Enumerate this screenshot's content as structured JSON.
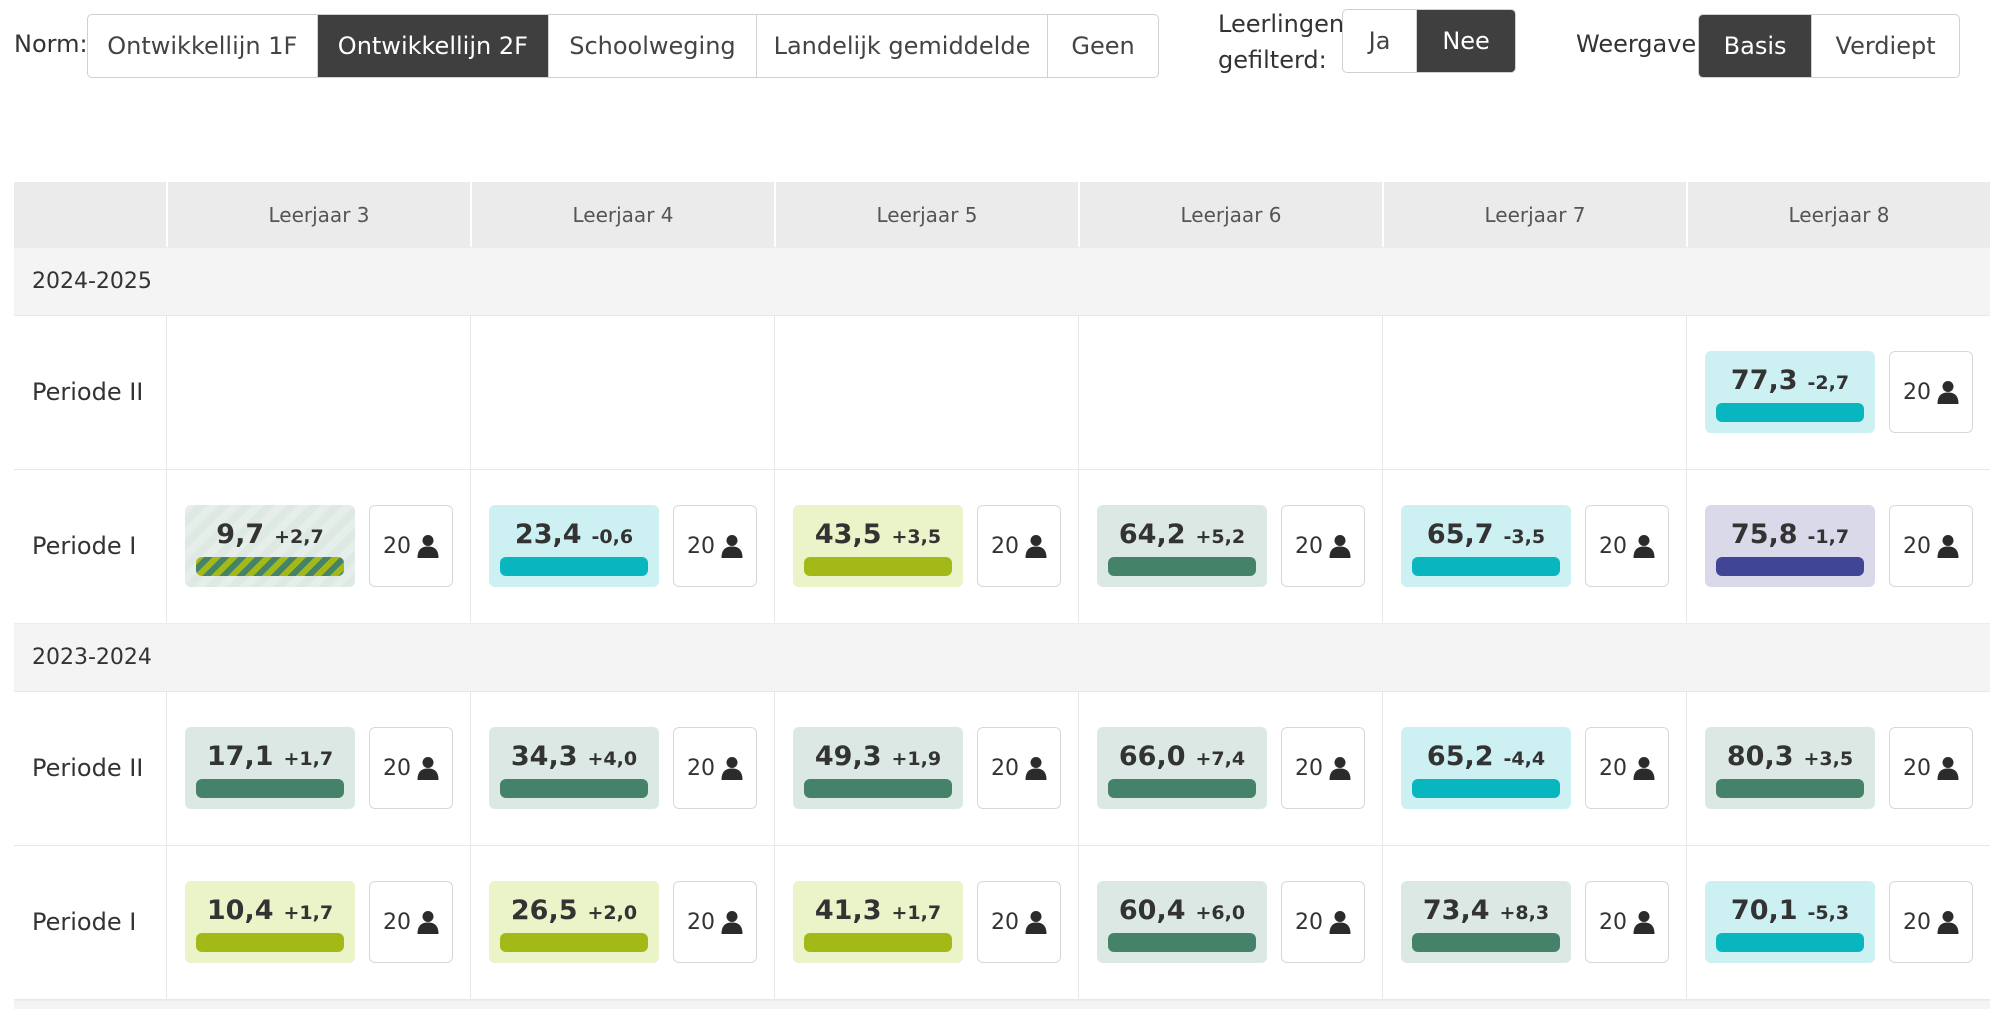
{
  "norm": {
    "label": "Norm:",
    "options": [
      "Ontwikkellijn 1F",
      "Ontwikkellijn 2F",
      "Schoolweging",
      "Landelijk gemiddelde",
      "Geen"
    ],
    "selected": "Ontwikkellijn 2F"
  },
  "leerlingen": {
    "label_line1": "Leerlingen",
    "label_line2": "gefilterd:",
    "options": [
      "Ja",
      "Nee"
    ],
    "selected": "Nee"
  },
  "weergave": {
    "label": "Weergave:",
    "options": [
      "Basis",
      "Verdiept"
    ],
    "selected": "Basis"
  },
  "colors": {
    "dark_green": {
      "bg": "#dbe8e3",
      "bar": "#44836a"
    },
    "teal": {
      "bg": "#cdf0f2",
      "bar": "#08b6c0"
    },
    "lime": {
      "bg": "#ebf3c9",
      "bar": "#a3b917"
    },
    "indigo": {
      "bg": "#d9d9ea",
      "bar": "#404596"
    },
    "striped": {
      "bg": "#e4ede9",
      "bar": "#8aa12a"
    }
  },
  "table": {
    "columns": [
      "Leerjaar 3",
      "Leerjaar 4",
      "Leerjaar 5",
      "Leerjaar 6",
      "Leerjaar 7",
      "Leerjaar 8"
    ],
    "years": [
      {
        "label": "2024-2025",
        "periods": [
          {
            "label": "Periode II",
            "cells": [
              null,
              null,
              null,
              null,
              null,
              {
                "value": "77,3",
                "delta": "-2,7",
                "count": "20",
                "color": "teal"
              }
            ]
          },
          {
            "label": "Periode I",
            "cells": [
              {
                "value": "9,7",
                "delta": "+2,7",
                "count": "20",
                "color": "striped"
              },
              {
                "value": "23,4",
                "delta": "-0,6",
                "count": "20",
                "color": "teal"
              },
              {
                "value": "43,5",
                "delta": "+3,5",
                "count": "20",
                "color": "lime"
              },
              {
                "value": "64,2",
                "delta": "+5,2",
                "count": "20",
                "color": "dark_green"
              },
              {
                "value": "65,7",
                "delta": "-3,5",
                "count": "20",
                "color": "teal"
              },
              {
                "value": "75,8",
                "delta": "-1,7",
                "count": "20",
                "color": "indigo"
              }
            ]
          }
        ]
      },
      {
        "label": "2023-2024",
        "periods": [
          {
            "label": "Periode II",
            "cells": [
              {
                "value": "17,1",
                "delta": "+1,7",
                "count": "20",
                "color": "dark_green"
              },
              {
                "value": "34,3",
                "delta": "+4,0",
                "count": "20",
                "color": "dark_green"
              },
              {
                "value": "49,3",
                "delta": "+1,9",
                "count": "20",
                "color": "dark_green"
              },
              {
                "value": "66,0",
                "delta": "+7,4",
                "count": "20",
                "color": "dark_green"
              },
              {
                "value": "65,2",
                "delta": "-4,4",
                "count": "20",
                "color": "teal"
              },
              {
                "value": "80,3",
                "delta": "+3,5",
                "count": "20",
                "color": "dark_green"
              }
            ]
          },
          {
            "label": "Periode I",
            "cells": [
              {
                "value": "10,4",
                "delta": "+1,7",
                "count": "20",
                "color": "lime"
              },
              {
                "value": "26,5",
                "delta": "+2,0",
                "count": "20",
                "color": "lime"
              },
              {
                "value": "41,3",
                "delta": "+1,7",
                "count": "20",
                "color": "lime"
              },
              {
                "value": "60,4",
                "delta": "+6,0",
                "count": "20",
                "color": "dark_green"
              },
              {
                "value": "73,4",
                "delta": "+8,3",
                "count": "20",
                "color": "dark_green"
              },
              {
                "value": "70,1",
                "delta": "-5,3",
                "count": "20",
                "color": "teal"
              }
            ]
          }
        ]
      }
    ]
  }
}
